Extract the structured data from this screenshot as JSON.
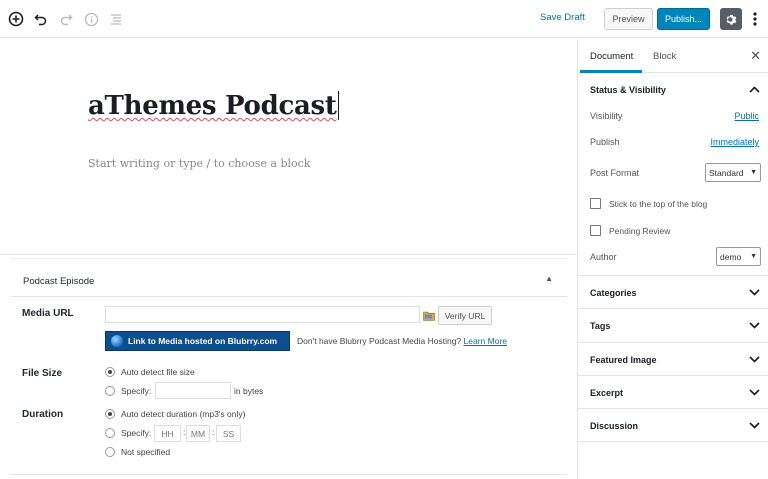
{
  "toolbar": {
    "save_draft": "Save Draft",
    "preview": "Preview",
    "publish": "Publish...",
    "icons": [
      "add-block-icon",
      "undo-icon",
      "redo-icon",
      "info-icon",
      "outline-icon",
      "gear-icon",
      "more-vertical-icon"
    ]
  },
  "editor": {
    "title": "aThemes Podcast",
    "placeholder": "Start writing or type / to choose a block"
  },
  "podcast": {
    "header": "Podcast Episode",
    "media_url_label": "Media URL",
    "media_url_value": "",
    "verify_button": "Verify URL",
    "blubrry_link": "Link to Media hosted on Blubrry.com",
    "blubrry_note": "Don't have Blubrry Podcast Media Hosting?",
    "learn_more": "Learn More",
    "file_size_label": "File Size",
    "file_size_auto": "Auto detect file size",
    "file_size_specify": "Specify:",
    "file_size_units": "in bytes",
    "duration_label": "Duration",
    "duration_auto": "Auto detect duration (mp3's only)",
    "duration_specify": "Specify:",
    "hh": "HH",
    "mm": "MM",
    "ss": "SS",
    "colon": ":",
    "not_specified": "Not specified"
  },
  "sidebar": {
    "tab_document": "Document",
    "tab_block": "Block",
    "close": "✕",
    "status_visibility": "Status & Visibility",
    "visibility_label": "Visibility",
    "visibility_value": "Public",
    "publish_label": "Publish",
    "publish_value": "Immediately",
    "post_format_label": "Post Format",
    "post_format_value": "Standard",
    "sticky_label": "Stick to the top of the blog",
    "pending_label": "Pending Review",
    "author_label": "Author",
    "author_value": "demo",
    "panels": [
      "Categories",
      "Tags",
      "Featured Image",
      "Excerpt",
      "Discussion"
    ]
  }
}
